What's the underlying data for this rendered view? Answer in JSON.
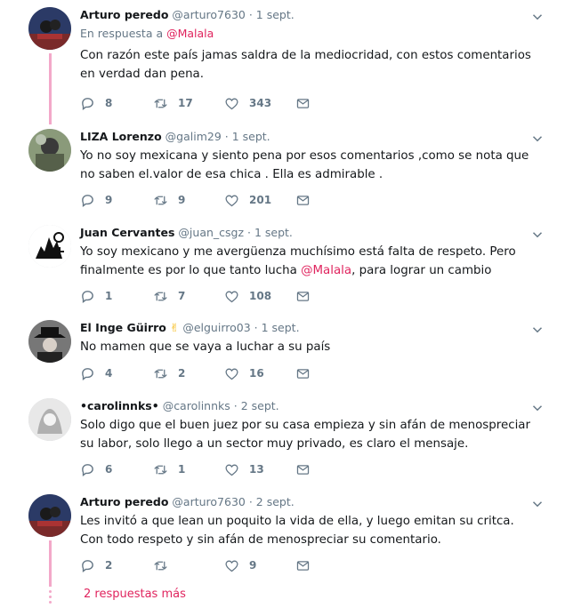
{
  "tweets": [
    {
      "name": "Arturo peredo",
      "handle": "@arturo7630",
      "date": "· 1 sept.",
      "reply_prefix": "En respuesta a ",
      "reply_mention": "@Malala",
      "text": "Con razón este país jamas saldra de la mediocridad, con estos comentarios en verdad dan pena.",
      "replies": "8",
      "retweets": "17",
      "likes": "343"
    },
    {
      "name": "LIZA Lorenzo",
      "handle": "@galim29",
      "date": "· 1 sept.",
      "text": "Yo no soy mexicana y siento pena por esos comentarios ,como se nota que no saben el.valor de esa chica . Ella es admirable .",
      "replies": "9",
      "retweets": "9",
      "likes": "201"
    },
    {
      "name": "Juan Cervantes",
      "handle": "@juan_csgz",
      "date": "· 1 sept.",
      "text_before": "Yo soy mexicano y me avergüenza muchísimo está falta de respeto. Pero finalmente es por lo que tanto lucha ",
      "text_mention": "@Malala",
      "text_after": ", para lograr un cambio",
      "replies": "1",
      "retweets": "7",
      "likes": "108"
    },
    {
      "name": "El Inge Güirro",
      "emoji": "✌",
      "handle": "@elguirro03",
      "date": "· 1 sept.",
      "text": "No mamen que se vaya a luchar a su país",
      "replies": "4",
      "retweets": "2",
      "likes": "16"
    },
    {
      "name": "•carolinnks•",
      "handle": "@carolinnks",
      "date": "· 2 sept.",
      "text": "Solo digo que el buen juez por su casa empieza y sin afán de menospreciar su labor, solo llego a un sector muy privado, es claro el mensaje.",
      "replies": "6",
      "retweets": "1",
      "likes": "13"
    },
    {
      "name": "Arturo peredo",
      "handle": "@arturo7630",
      "date": "· 2 sept.",
      "text": "Les invitó a que lean un poquito la vida de ella, y luego emitan su critca. Con todo respeto y sin afán de menospreciar su comentario.",
      "replies": "2",
      "retweets": "",
      "likes": "9"
    }
  ],
  "more_replies": "2 respuestas más",
  "colors": {
    "accent": "#e0245e",
    "thread_line": "#f3a8c9",
    "meta": "#657786"
  },
  "icons": [
    "reply-icon",
    "retweet-icon",
    "like-icon",
    "message-icon",
    "chevron-down-icon"
  ]
}
